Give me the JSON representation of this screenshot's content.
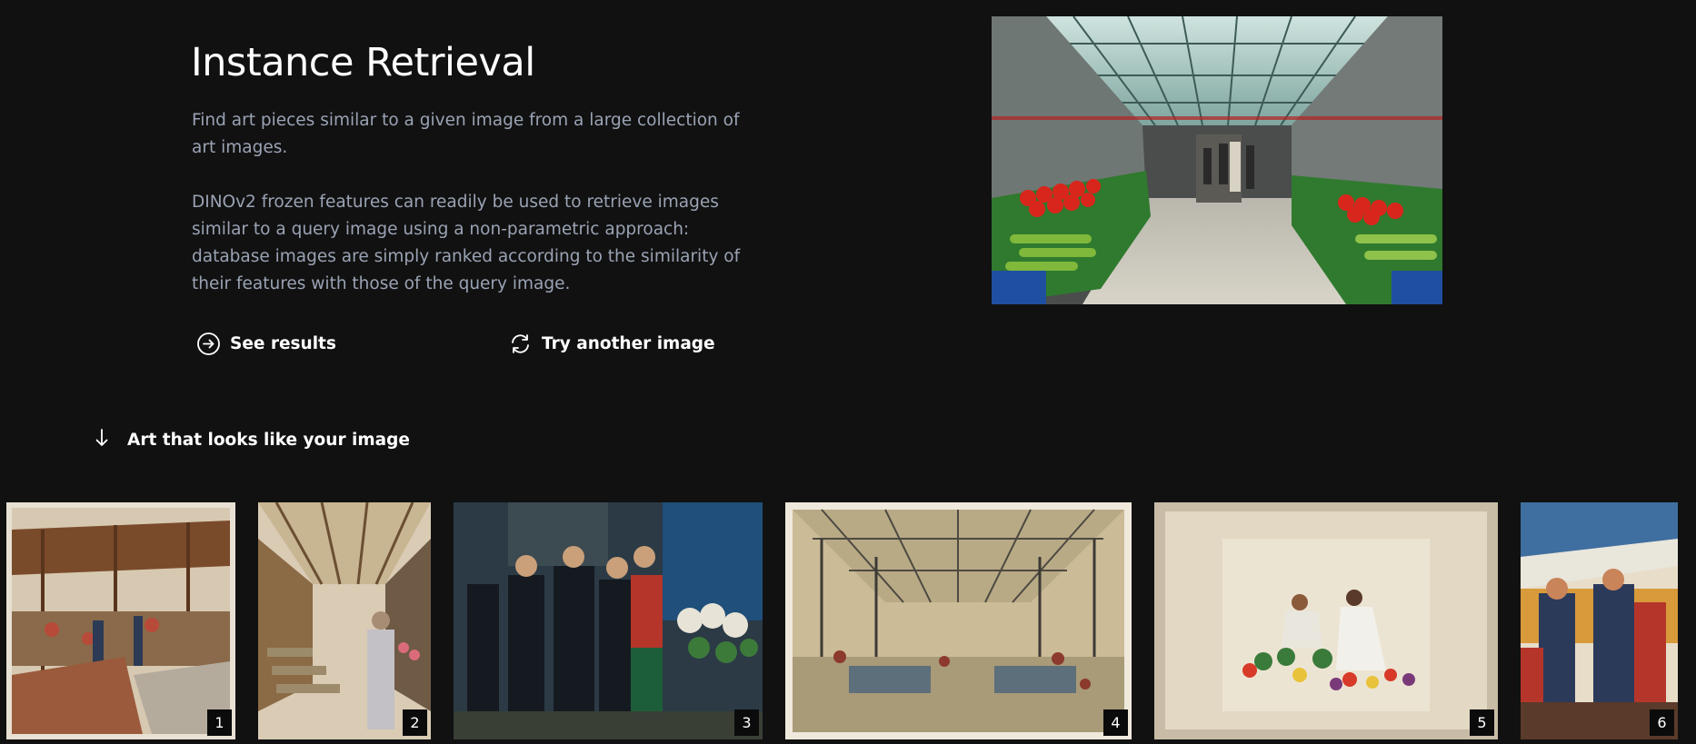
{
  "header": {
    "title": "Instance Retrieval",
    "description_1": "Find art pieces similar to a given image from a large collection of art images.",
    "description_2": "DINOv2 frozen features can readily be used to retrieve images similar to a query image using a non-parametric approach: database images are simply ranked according to the similarity of their features with those of the query image."
  },
  "actions": {
    "see_results": {
      "label": "See results",
      "icon": "arrow-right-circle-icon"
    },
    "try_another": {
      "label": "Try another image",
      "icon": "refresh-icon"
    }
  },
  "query_image": {
    "label": ""
  },
  "results_section": {
    "heading": "Art that looks like your image",
    "icon": "arrow-down-icon",
    "items": [
      {
        "rank": "1"
      },
      {
        "rank": "2"
      },
      {
        "rank": "3"
      },
      {
        "rank": "4"
      },
      {
        "rank": "5"
      },
      {
        "rank": "6"
      }
    ]
  },
  "colors": {
    "background": "#111111",
    "text_primary": "#ffffff",
    "text_secondary": "#9aa3b4"
  }
}
